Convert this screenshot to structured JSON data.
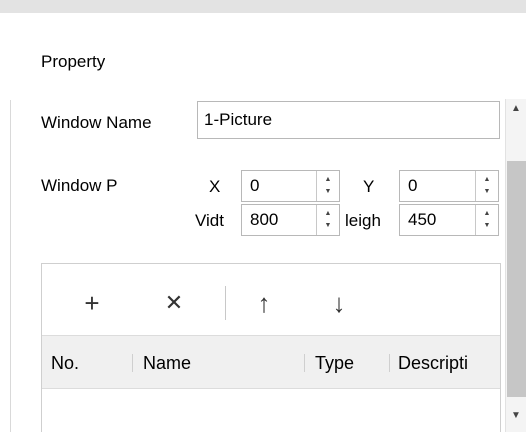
{
  "panel": {
    "title": "Property",
    "window_name_label": "Window Name",
    "window_name_value": "1-Picture",
    "window_pos_label": "Window P",
    "x_label": "X",
    "x_value": "0",
    "y_label": "Y",
    "y_value": "0",
    "width_label": "Vidt",
    "width_value": "800",
    "height_label": "leigh",
    "height_value": "450"
  },
  "toolbar": {
    "add_glyph": "+",
    "delete_glyph": "✕",
    "up_glyph": "↑",
    "down_glyph": "↓"
  },
  "table": {
    "columns": [
      "No.",
      "Name",
      "Type",
      "Descripti"
    ]
  },
  "colors": {
    "panel_bg": "#ffffff",
    "header_bg": "#f0f0f0",
    "scroll_thumb": "#c6c6c6"
  }
}
